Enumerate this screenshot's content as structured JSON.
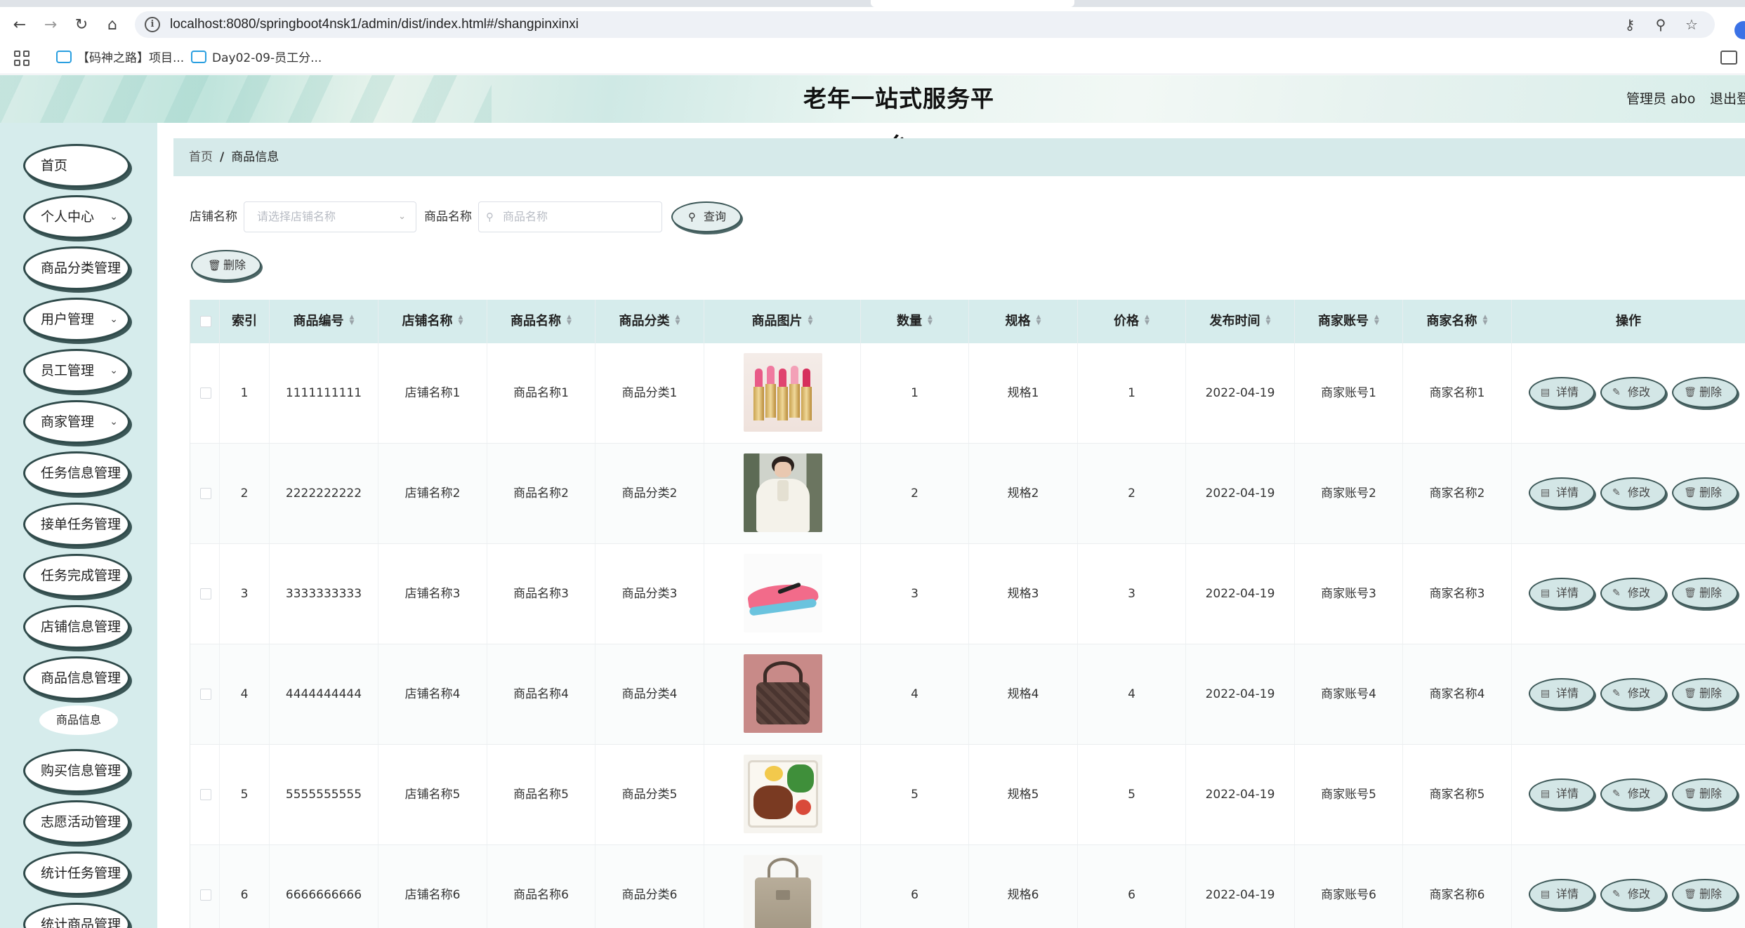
{
  "browser": {
    "url": "localhost:8080/springboot4nsk1/admin/dist/index.html#/shangpinxinxi",
    "bookmarks": [
      {
        "label": "【码神之路】项目..."
      },
      {
        "label": "Day02-09-员工分..."
      }
    ]
  },
  "header": {
    "title": "老年一站式服务平台",
    "user": "管理员 abo",
    "logout": "退出登"
  },
  "sidebar": {
    "items": [
      {
        "label": "首页",
        "has_arrow": false
      },
      {
        "label": "个人中心",
        "has_arrow": true
      },
      {
        "label": "商品分类管理",
        "has_arrow": false
      },
      {
        "label": "用户管理",
        "has_arrow": true
      },
      {
        "label": "员工管理",
        "has_arrow": true
      },
      {
        "label": "商家管理",
        "has_arrow": true
      },
      {
        "label": "任务信息管理",
        "has_arrow": false
      },
      {
        "label": "接单任务管理",
        "has_arrow": false
      },
      {
        "label": "任务完成管理",
        "has_arrow": false
      },
      {
        "label": "店铺信息管理",
        "has_arrow": false
      },
      {
        "label": "商品信息管理",
        "has_arrow": false
      },
      {
        "label": "购买信息管理",
        "has_arrow": false
      },
      {
        "label": "志愿活动管理",
        "has_arrow": false
      },
      {
        "label": "统计任务管理",
        "has_arrow": false
      },
      {
        "label": "统计商品管理",
        "has_arrow": false
      }
    ],
    "subitem": {
      "label": "商品信息"
    }
  },
  "breadcrumb": {
    "home": "首页",
    "separator": "/",
    "current": "商品信息"
  },
  "search": {
    "shop_label": "店铺名称",
    "shop_placeholder": "请选择店铺名称",
    "product_label": "商品名称",
    "product_placeholder": "商品名称",
    "query_button": "查询",
    "delete_button": "删除"
  },
  "table": {
    "columns": {
      "index": "索引",
      "code": "商品编号",
      "shop": "店铺名称",
      "name": "商品名称",
      "category": "商品分类",
      "image": "商品图片",
      "qty": "数量",
      "spec": "规格",
      "price": "价格",
      "date": "发布时间",
      "merchant_acct": "商家账号",
      "merchant_name": "商家名称",
      "actions": "操作"
    },
    "actions": {
      "detail": "详情",
      "edit": "修改",
      "delete": "删除"
    },
    "rows": [
      {
        "index": "1",
        "code": "1111111111",
        "shop": "店铺名称1",
        "name": "商品名称1",
        "category": "商品分类1",
        "image_icon": "lipstick-image",
        "qty": "1",
        "spec": "规格1",
        "price": "1",
        "date": "2022-04-19",
        "merchant_acct": "商家账号1",
        "merchant_name": "商家名称1"
      },
      {
        "index": "2",
        "code": "2222222222",
        "shop": "店铺名称2",
        "name": "商品名称2",
        "category": "商品分类2",
        "image_icon": "blouse-image",
        "qty": "2",
        "spec": "规格2",
        "price": "2",
        "date": "2022-04-19",
        "merchant_acct": "商家账号2",
        "merchant_name": "商家名称2"
      },
      {
        "index": "3",
        "code": "3333333333",
        "shop": "店铺名称3",
        "name": "商品名称3",
        "category": "商品分类3",
        "image_icon": "sneaker-image",
        "qty": "3",
        "spec": "规格3",
        "price": "3",
        "date": "2022-04-19",
        "merchant_acct": "商家账号3",
        "merchant_name": "商家名称3"
      },
      {
        "index": "4",
        "code": "4444444444",
        "shop": "店铺名称4",
        "name": "商品名称4",
        "category": "商品分类4",
        "image_icon": "handbag-image",
        "qty": "4",
        "spec": "规格4",
        "price": "4",
        "date": "2022-04-19",
        "merchant_acct": "商家账号4",
        "merchant_name": "商家名称4"
      },
      {
        "index": "5",
        "code": "5555555555",
        "shop": "店铺名称5",
        "name": "商品名称5",
        "category": "商品分类5",
        "image_icon": "food-box-image",
        "qty": "5",
        "spec": "规格5",
        "price": "5",
        "date": "2022-04-19",
        "merchant_acct": "商家账号5",
        "merchant_name": "商家名称5"
      },
      {
        "index": "6",
        "code": "6666666666",
        "shop": "店铺名称6",
        "name": "商品名称6",
        "category": "商品分类6",
        "image_icon": "tote-bag-image",
        "qty": "6",
        "spec": "规格6",
        "price": "6",
        "date": "2022-04-19",
        "merchant_acct": "商家账号6",
        "merchant_name": "商家名称6"
      }
    ]
  },
  "colors": {
    "accent": "#d6ecec",
    "button_border": "#3b5656",
    "action_fill": "#d3e6e6"
  }
}
